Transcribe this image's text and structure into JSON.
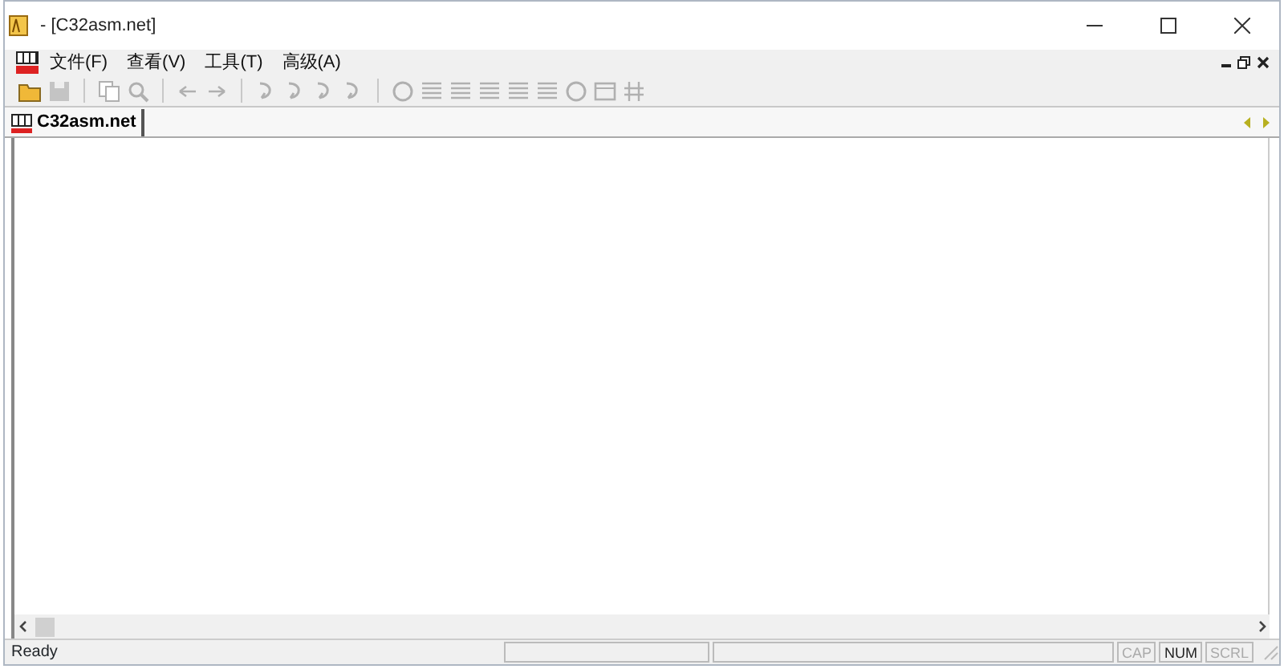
{
  "window": {
    "title": "- [C32asm.net]"
  },
  "menu": [
    {
      "label": "文件(F)"
    },
    {
      "label": "查看(V)"
    },
    {
      "label": "工具(T)"
    },
    {
      "label": "高级(A)"
    }
  ],
  "toolbar": [
    {
      "kind": "folder",
      "disabled": false
    },
    {
      "kind": "disk",
      "disabled": true
    },
    {
      "kind": "sep"
    },
    {
      "kind": "pages",
      "disabled": true
    },
    {
      "kind": "magnifier",
      "disabled": true
    },
    {
      "kind": "sep"
    },
    {
      "kind": "left",
      "disabled": true
    },
    {
      "kind": "right",
      "disabled": true
    },
    {
      "kind": "sep"
    },
    {
      "kind": "curve",
      "disabled": true
    },
    {
      "kind": "curve",
      "disabled": true
    },
    {
      "kind": "curve",
      "disabled": true
    },
    {
      "kind": "curve",
      "disabled": true
    },
    {
      "kind": "sep"
    },
    {
      "kind": "circle",
      "disabled": true
    },
    {
      "kind": "list",
      "disabled": true
    },
    {
      "kind": "list",
      "disabled": true
    },
    {
      "kind": "list",
      "disabled": true
    },
    {
      "kind": "list",
      "disabled": true
    },
    {
      "kind": "list",
      "disabled": true
    },
    {
      "kind": "circle",
      "disabled": true
    },
    {
      "kind": "rect",
      "disabled": true
    },
    {
      "kind": "grid",
      "disabled": true
    }
  ],
  "tabs": [
    {
      "label": "C32asm.net",
      "selected": true
    }
  ],
  "status_bar": {
    "text": "Ready",
    "indicators": [
      {
        "label": "CAP",
        "on": false
      },
      {
        "label": "NUM",
        "on": true
      },
      {
        "label": "SCRL",
        "on": false
      }
    ]
  }
}
